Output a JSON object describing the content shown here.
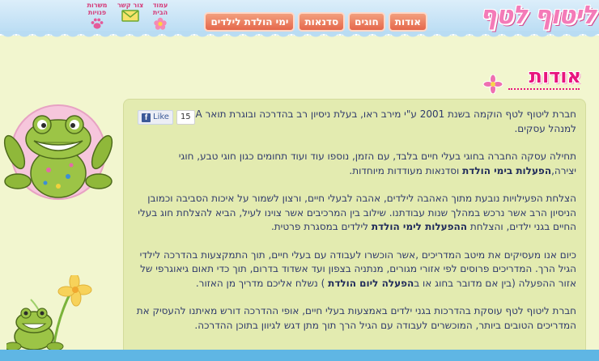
{
  "site": {
    "logo_text": "ליטוף לטף"
  },
  "nav": {
    "tabs": [
      {
        "label": "אודות"
      },
      {
        "label": "חוגים"
      },
      {
        "label": "סדנאות"
      },
      {
        "label": "ימי הולדת לילדים"
      }
    ],
    "icons": [
      {
        "label": "עמוד הבית",
        "icon": "flower-icon"
      },
      {
        "label": "צור קשר",
        "icon": "envelope-icon"
      },
      {
        "label": "משרות פנויות",
        "icon": "paw-icon"
      }
    ]
  },
  "page": {
    "title": "אודות"
  },
  "facebook": {
    "like_label": "Like",
    "count": "15"
  },
  "article": {
    "p1": "חברת ליטוף לטף הוקמה בשנת 2001 ע\"י מירב ראו, בעלת ניסיון רב בהדרכה ובוגרת תואר BA למנהל עסקים.",
    "p2_a": "תחילה עסקה החברה בחוגי בעלי חיים בלבד, עם הזמן, נוספו עוד ועוד תחומים כגון חוגי טבע, חוגי יצירה,",
    "p2_b": "הפעלות בימי הולדת",
    "p2_c": " וסדנאות מעודדות מיוחדות.",
    "p3_a": "הצלחת הפעילויות נובעת מתוך האהבה לילדים, אהבה לבעלי חיים, ורצון לשמור על איכות הסביבה וכמובן הניסיון הרב אשר נרכש במהלך שנות עבודתנו. שילוב בין המרכיבים אשר צוינו לעיל, הביא להצלחת חוג בעלי החיים בגני ילדים, והצלחת ",
    "p3_b": "ההפעלות לימי הולדת",
    "p3_c": " לילדים במסגרת פרטית.",
    "p4_a": "כיום אנו מעסיקים את מיטב המדריכים ,אשר הוכשרו לעבודה עם בעלי חיים, תוך התמקצעות בהדרכה לילדי הגיל הרך. המדריכים פרוסים לפי אזורי מגורים, מנתניה בצפון ועד אשדוד בדרום, תוך כדי תאום גיאוגרפי של אזור ההפעלה (בין אם מדובר בחוג או ב",
    "p4_b": "הפעלה ליום הולדת",
    "p4_c": " ) נשלח אליכם מדריך מן האזור.",
    "p5": "חברת ליטוף לטף עוסקת בהדרכות בגני ילדים באמצעות בעלי חיים, אופי ההדרכה דורש מאיתנו להעסיק את המדריכים הטובים ביותר, המוכשרים לעבודה עם הגיל הרך תוך מתן דגש לגיוון בתוכן ההדרכה."
  },
  "colors": {
    "accent_pink": "#e8157e",
    "nav_orange": "#e5674b",
    "background": "#f2f6cf",
    "content_bg": "#e3ebb0",
    "text": "#2f3a6b"
  }
}
